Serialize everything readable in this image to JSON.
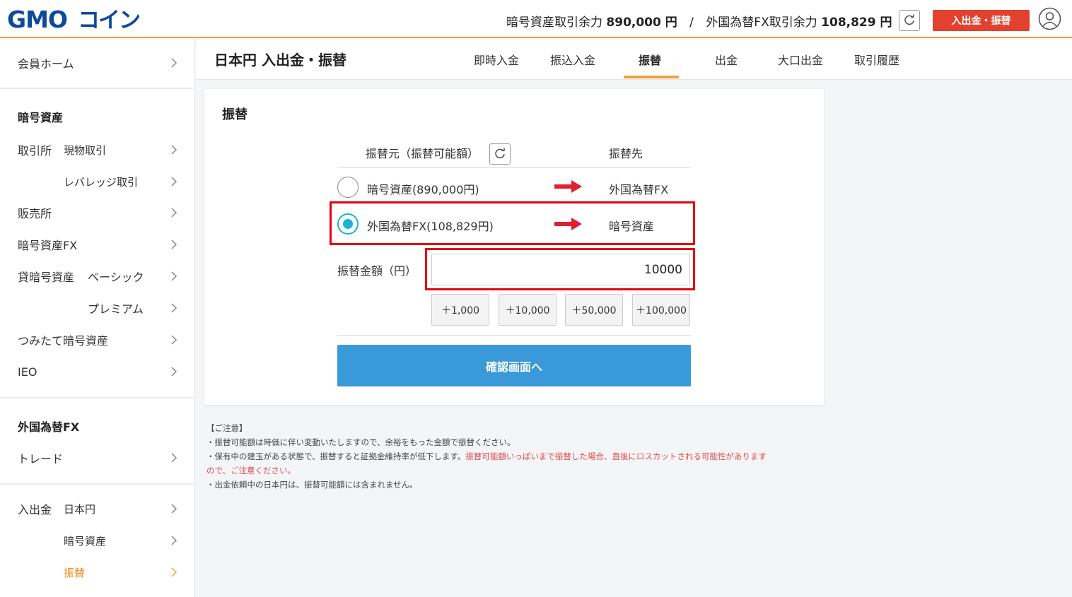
{
  "header": {
    "logo": "GMOコイン",
    "crypto_balance_label": "暗号資産取引余力",
    "crypto_balance_value": "890,000 円",
    "separator": "/",
    "fx_balance_label": "外国為替FX取引余力",
    "fx_balance_value": "108,829 円",
    "deposit_button": "入出金・振替"
  },
  "sidebar": {
    "home": "会員ホーム",
    "crypto_heading": "暗号資産",
    "exchange": "取引所",
    "spot": "現物取引",
    "leverage": "レバレッジ取引",
    "sales": "販売所",
    "crypto_fx": "暗号資産FX",
    "lending": "貸暗号資産",
    "basic": "ベーシック",
    "premium": "プレミアム",
    "tsumitate": "つみたて暗号資産",
    "ieo": "IEO",
    "fx_heading": "外国為替FX",
    "trade": "トレード",
    "deposit_withdraw": "入出金",
    "jpy": "日本円",
    "crypto": "暗号資産",
    "transfer": "振替"
  },
  "main": {
    "title": "日本円 入出金・振替",
    "tabs": [
      {
        "label": "即時入金",
        "active": false
      },
      {
        "label": "振込入金",
        "active": false
      },
      {
        "label": "振替",
        "active": true
      },
      {
        "label": "出金",
        "active": false
      },
      {
        "label": "大口出金",
        "active": false
      },
      {
        "label": "取引履歴",
        "active": false
      }
    ]
  },
  "card": {
    "title": "振替",
    "from_header": "振替元（振替可能額）",
    "to_header": "振替先",
    "options": [
      {
        "from": "暗号資産(890,000円)",
        "to": "外国為替FX",
        "selected": false
      },
      {
        "from": "外国為替FX(108,829円)",
        "to": "暗号資産",
        "selected": true
      }
    ],
    "amount_label": "振替金額（円）",
    "amount_value": "10000",
    "quick_buttons": [
      "＋1,000",
      "＋10,000",
      "＋50,000",
      "＋100,000"
    ],
    "confirm_button": "確認画面へ"
  },
  "notes": {
    "heading": "【ご注意】",
    "line1": "・振替可能額は時価に伴い変動いたしますので、余裕をもった金額で振替ください。",
    "line2_normal": "・保有中の建玉がある状態で、振替すると証拠金維持率が低下します。",
    "line2_red": "振替可能額いっぱいまで振替した場合、直後にロスカットされる可能性があります",
    "line2_red_cont": "ので、ご注意ください。",
    "line3": "・出金依頼中の日本円は、振替可能額には含まれません。"
  },
  "colors": {
    "accent_orange": "#f2a13b",
    "deposit_red": "#e2412f",
    "confirm_blue": "#3a9ad9",
    "radio_cyan": "#1bb3d6",
    "highlight_red": "#e4000f",
    "arrow_red": "#e0202e"
  },
  "icons": {
    "refresh": "refresh-icon",
    "user": "user-icon",
    "chevron": "chevron-right-icon",
    "arrow": "arrow-right-icon"
  }
}
